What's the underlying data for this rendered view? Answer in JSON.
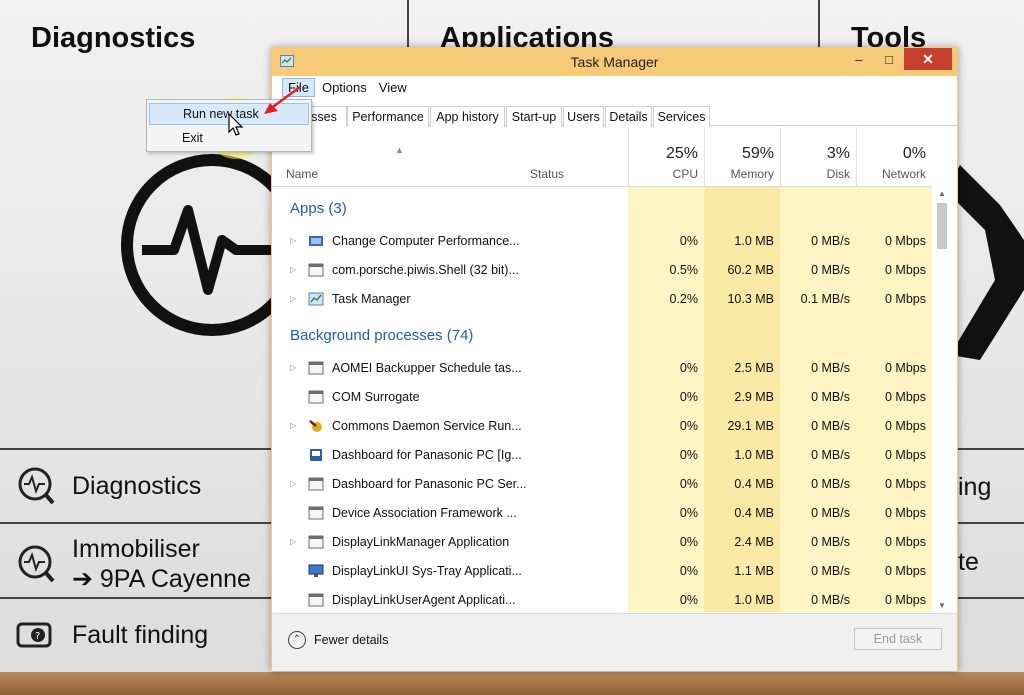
{
  "background_app": {
    "columns": [
      "Diagnostics",
      "Applications",
      "Tools"
    ],
    "menu": [
      {
        "label": "Diagnostics",
        "icon": "magnifier-pulse-icon"
      },
      {
        "label": "Immobiliser",
        "sublabel": "➔ 9PA Cayenne",
        "icon": "magnifier-pulse-icon"
      },
      {
        "label": "Fault finding",
        "icon": "engine-question-icon"
      }
    ],
    "right_fragments": [
      "ing",
      "te"
    ]
  },
  "window": {
    "title": "Task Manager",
    "buttons": {
      "minimize": "–",
      "maximize": "□",
      "close": "✕"
    },
    "accent_color": "#f7ca77"
  },
  "menubar": [
    "File",
    "Options",
    "View"
  ],
  "file_menu": {
    "items": [
      "Run new task",
      "Exit"
    ],
    "highlighted": "Run new task"
  },
  "tabs": [
    "esses",
    "Performance",
    "App history",
    "Start-up",
    "Users",
    "Details",
    "Services"
  ],
  "columns": {
    "name": "Name",
    "status": "Status",
    "cpu": {
      "pct": "25%",
      "label": "CPU"
    },
    "memory": {
      "pct": "59%",
      "label": "Memory"
    },
    "disk": {
      "pct": "3%",
      "label": "Disk"
    },
    "network": {
      "pct": "0%",
      "label": "Network"
    }
  },
  "groups": [
    {
      "label": "Apps (3)",
      "rows": [
        {
          "name": "Change Computer Performance...",
          "icon": "performance-icon",
          "expand": true,
          "cpu": "0%",
          "mem": "1.0 MB",
          "disk": "0 MB/s",
          "net": "0 Mbps"
        },
        {
          "name": "com.porsche.piwis.Shell (32 bit)...",
          "icon": "window-icon",
          "expand": true,
          "cpu": "0.5%",
          "mem": "60.2 MB",
          "disk": "0 MB/s",
          "net": "0 Mbps"
        },
        {
          "name": "Task Manager",
          "icon": "task-manager-icon",
          "expand": true,
          "cpu": "0.2%",
          "mem": "10.3 MB",
          "disk": "0.1 MB/s",
          "net": "0 Mbps"
        }
      ]
    },
    {
      "label": "Background processes (74)",
      "rows": [
        {
          "name": "AOMEI Backupper Schedule tas...",
          "icon": "window-icon",
          "expand": true,
          "cpu": "0%",
          "mem": "2.5 MB",
          "disk": "0 MB/s",
          "net": "0 Mbps"
        },
        {
          "name": "COM Surrogate",
          "icon": "window-icon",
          "expand": false,
          "cpu": "0%",
          "mem": "2.9 MB",
          "disk": "0 MB/s",
          "net": "0 Mbps"
        },
        {
          "name": "Commons Daemon Service Run...",
          "icon": "daemon-icon",
          "expand": true,
          "cpu": "0%",
          "mem": "29.1 MB",
          "disk": "0 MB/s",
          "net": "0 Mbps"
        },
        {
          "name": "Dashboard for Panasonic PC [Ig...",
          "icon": "dashboard-icon",
          "expand": false,
          "cpu": "0%",
          "mem": "1.0 MB",
          "disk": "0 MB/s",
          "net": "0 Mbps"
        },
        {
          "name": "Dashboard for Panasonic PC Ser...",
          "icon": "window-icon",
          "expand": true,
          "cpu": "0%",
          "mem": "0.4 MB",
          "disk": "0 MB/s",
          "net": "0 Mbps"
        },
        {
          "name": "Device Association Framework ...",
          "icon": "window-icon",
          "expand": false,
          "cpu": "0%",
          "mem": "0.4 MB",
          "disk": "0 MB/s",
          "net": "0 Mbps"
        },
        {
          "name": "DisplayLinkManager Application",
          "icon": "window-icon",
          "expand": true,
          "cpu": "0%",
          "mem": "2.4 MB",
          "disk": "0 MB/s",
          "net": "0 Mbps"
        },
        {
          "name": "DisplayLinkUI Sys-Tray Applicati...",
          "icon": "monitor-icon",
          "expand": false,
          "cpu": "0%",
          "mem": "1.1 MB",
          "disk": "0 MB/s",
          "net": "0 Mbps"
        },
        {
          "name": "DisplayLinkUserAgent Applicati...",
          "icon": "window-icon",
          "expand": false,
          "cpu": "0%",
          "mem": "1.0 MB",
          "disk": "0 MB/s",
          "net": "0 Mbps"
        }
      ]
    }
  ],
  "footer": {
    "fewer_details": "Fewer details",
    "end_task": "End task"
  }
}
